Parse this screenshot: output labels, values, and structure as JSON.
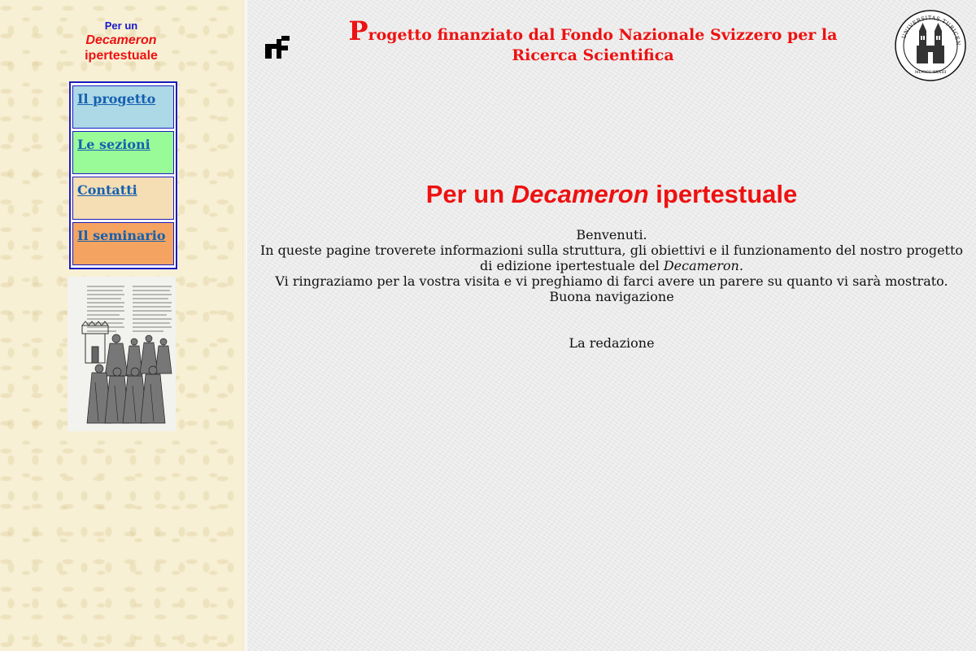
{
  "sidebar": {
    "title_line1": "Per un",
    "title_line2": "Decameron",
    "title_line3": "ipertestuale",
    "menu": [
      {
        "label": "Il progetto",
        "color": "#add8e6"
      },
      {
        "label": "Le sezioni",
        "color": "#98fb98"
      },
      {
        "label": "Contatti",
        "color": "#f5deb3"
      },
      {
        "label": "Il seminario",
        "color": "#f4a460"
      }
    ],
    "image_icon": "manuscript-illustration"
  },
  "header": {
    "funding_initial": "P",
    "funding_text": "rogetto finanziato dal Fondo Nazionale Svizzero per la Ricerca Scientifica",
    "left_logo_icon": "fnsnf-logo-icon",
    "right_logo_icon": "university-seal-icon",
    "seal_text": "UNIVERSITAS TURICENSIS",
    "seal_year": "MDCCC XXXIII"
  },
  "content": {
    "heading_pre": "Per un ",
    "heading_italic": "Decameron",
    "heading_post": " ipertestuale",
    "welcome": "Benvenuti.",
    "intro_pre": "In queste pagine troverete informazioni sulla struttura, gli obiettivi e il funzionamento del nostro progetto di edizione ipertestuale del ",
    "intro_italic": "Decameron",
    "intro_post": ".",
    "thanks": "Vi ringraziamo per la vostra visita e vi preghiamo di farci avere un parere su quanto vi sarà mostrato.",
    "goodbye": "Buona navigazione",
    "signature": "La redazione"
  },
  "colors": {
    "accent_red": "#ee1111",
    "title_blue": "#1a1acc",
    "link_blue": "#1560b0",
    "menu_border": "#1b1bbf"
  }
}
